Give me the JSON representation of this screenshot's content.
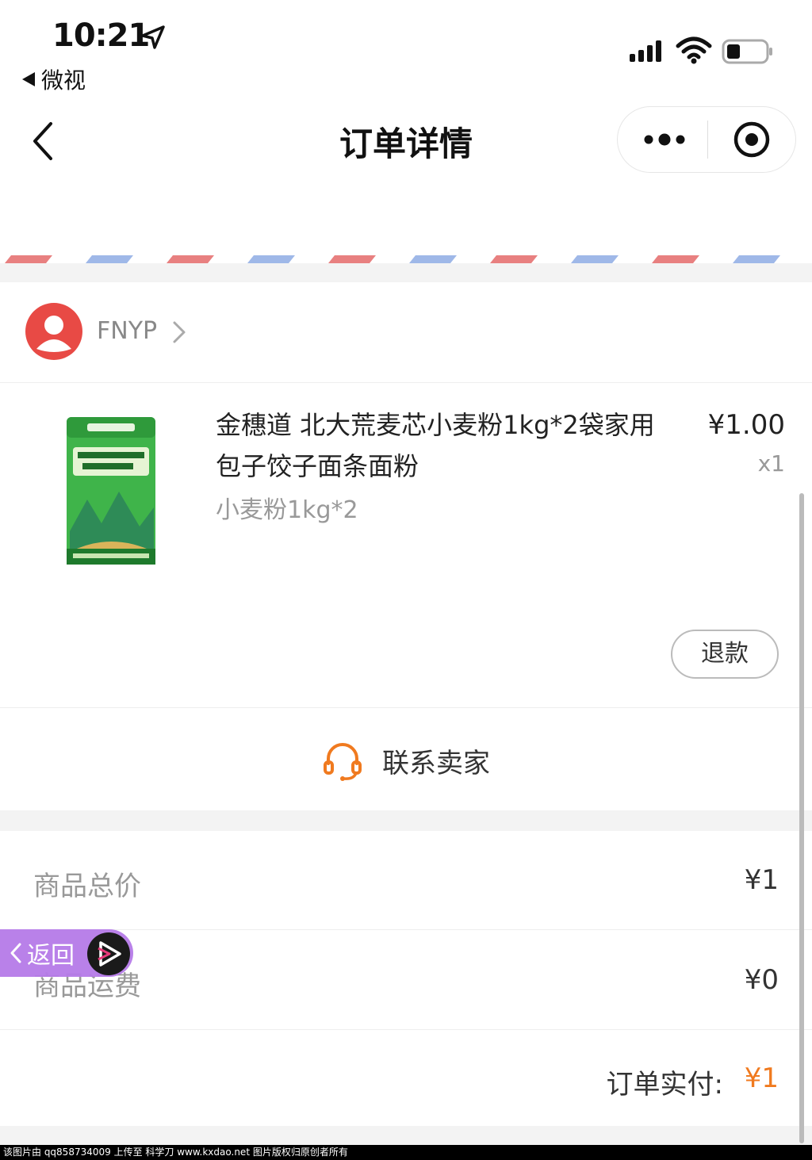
{
  "status_bar": {
    "time": "10:21",
    "back_app": "微视",
    "icons": [
      "location-arrow-icon",
      "signal-icon",
      "wifi-icon",
      "battery-icon"
    ]
  },
  "nav": {
    "title": "订单详情",
    "icons": [
      "back-chevron-icon",
      "more-dots-icon",
      "target-icon"
    ]
  },
  "shop": {
    "name": "FNYP"
  },
  "product": {
    "title": "金穗道 北大荒麦芯小麦粉1kg*2袋家用包子饺子面条面粉",
    "sku": "小麦粉1kg*2",
    "price": "¥1.00",
    "qty": "x1",
    "refund_label": "退款"
  },
  "contact": {
    "label": "联系卖家"
  },
  "summary": {
    "goods_total_label": "商品总价",
    "goods_total_value": "¥1",
    "shipping_label": "商品运费",
    "shipping_value": "¥0",
    "paid_label": "订单实付:",
    "paid_value": "¥1"
  },
  "floating": {
    "back_label": "返回"
  },
  "watermark": "该图片由 qq858734009 上传至 科学刀 www.kxdao.net 图片版权归原创者所有",
  "colors": {
    "accent_orange": "#f07a1f",
    "avatar_red": "#e84a45",
    "stripe_red": "#e88080",
    "stripe_blue": "#9fb8e8",
    "float_purple": "#b57ae8"
  }
}
